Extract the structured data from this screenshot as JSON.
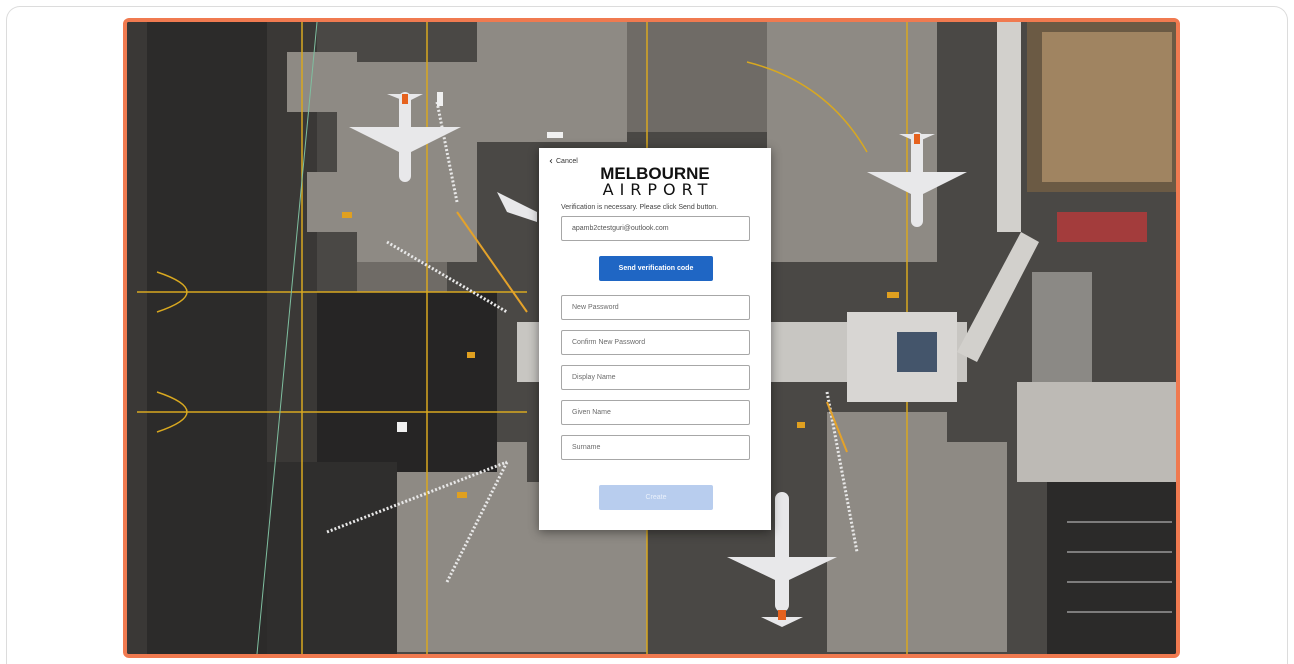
{
  "modal": {
    "cancel_label": "Cancel",
    "logo_line1": "MELBOURNE",
    "logo_line2": "AIRPORT",
    "hint_text": "Verification is necessary. Please click Send button.",
    "email_value": "apamb2ctestguri@outlook.com",
    "send_code_label": "Send verification code",
    "new_password_placeholder": "New Password",
    "confirm_password_placeholder": "Confirm New Password",
    "display_name_placeholder": "Display Name",
    "given_name_placeholder": "Given Name",
    "surname_placeholder": "Surname",
    "create_label": "Create"
  },
  "colors": {
    "highlight_border": "#f07a50",
    "primary_button": "#1f66c4",
    "disabled_button": "#b8cdee"
  },
  "icons": {
    "cancel": "chevron-left-icon"
  }
}
